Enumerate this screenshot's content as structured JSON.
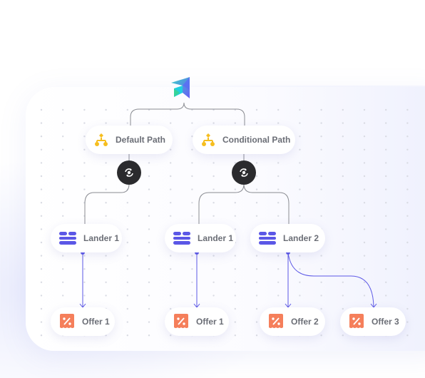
{
  "colors": {
    "path_icon": "#F6BE1F",
    "lander_icon": "#5B57E6",
    "offer_icon": "#F57F5B",
    "connector_gray": "#8a8c92",
    "connector_blue": "#5B57E6",
    "rotator_bg": "#2b2b2e"
  },
  "logo": {
    "icon": "brand-logo-icon"
  },
  "paths": [
    {
      "label": "Default Path",
      "icon": "hierarchy-icon"
    },
    {
      "label": "Conditional Path",
      "icon": "hierarchy-icon"
    }
  ],
  "rotators": [
    {
      "icon": "rotate-icon"
    },
    {
      "icon": "rotate-icon"
    }
  ],
  "landers": [
    {
      "label": "Lander 1",
      "icon": "lander-icon"
    },
    {
      "label": "Lander 1",
      "icon": "lander-icon"
    },
    {
      "label": "Lander 2",
      "icon": "lander-icon"
    }
  ],
  "offers": [
    {
      "label": "Offer 1",
      "icon": "offer-icon"
    },
    {
      "label": "Offer 1",
      "icon": "offer-icon"
    },
    {
      "label": "Offer 2",
      "icon": "offer-icon"
    },
    {
      "label": "Offer 3",
      "icon": "offer-icon"
    }
  ]
}
